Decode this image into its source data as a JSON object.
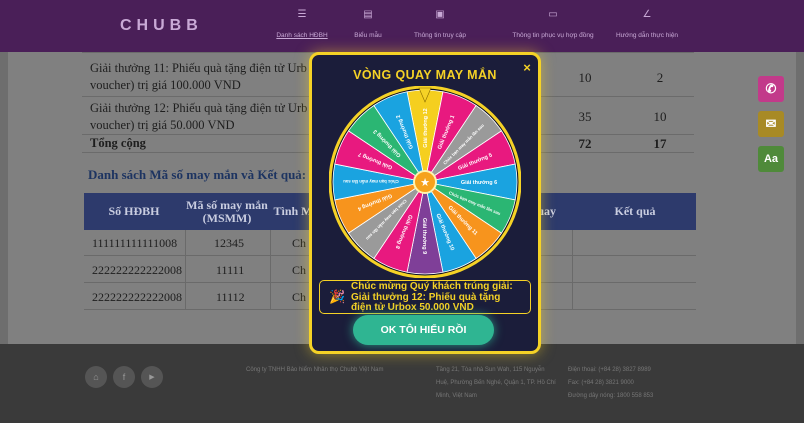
{
  "nav": {
    "logo": "CHUBB",
    "items": [
      {
        "label": "Danh sách HĐBH",
        "icon": "list-icon",
        "glyph": "☰"
      },
      {
        "label": "Biểu mẫu",
        "icon": "document-icon",
        "glyph": "▤"
      },
      {
        "label": "Thông tin truy cập",
        "icon": "user-card-icon",
        "glyph": "▣"
      },
      {
        "label": "Thông tin phục vụ hợp đồng",
        "icon": "chat-icon",
        "glyph": "▭"
      },
      {
        "label": "Hướng dẫn thực hiện",
        "icon": "pen-icon",
        "glyph": "∠"
      }
    ]
  },
  "prizes": [
    {
      "line1": "Giải thưởng 11: Phiếu quà tặng điện tử Urb",
      "line2": "voucher) trị giá 100.000 VND",
      "a": "10",
      "b": "2"
    },
    {
      "line1": "Giải thưởng 12: Phiếu quà tặng điện tử Urb",
      "line2": "voucher) trị giá 50.000 VND",
      "a": "35",
      "b": "10"
    }
  ],
  "total": {
    "label": "Tổng cộng",
    "a": "72",
    "b": "17"
  },
  "lucky": {
    "title": "Danh sách Mã số may mắn và Kết quả:",
    "headers": [
      "Số HĐBH",
      "Mã số may mắn (MSMM)",
      "Tình M",
      "Quay",
      "Kết quả"
    ],
    "rows": [
      {
        "policy": "111111111111008",
        "code": "12345",
        "status": "Ch"
      },
      {
        "policy": "222222222222008",
        "code": "11111",
        "status": "Ch"
      },
      {
        "policy": "222222222222008",
        "code": "11112",
        "status": "Ch"
      }
    ]
  },
  "side_buttons": [
    {
      "name": "phone-icon",
      "glyph": "✆",
      "color": "#c23a8a"
    },
    {
      "name": "chat-bubble-icon",
      "glyph": "✉",
      "color": "#a88a25"
    },
    {
      "name": "font-size-icon",
      "glyph": "Aa",
      "color": "#4f8a3a"
    }
  ],
  "footer": {
    "social": [
      {
        "name": "home-icon",
        "glyph": "⌂"
      },
      {
        "name": "facebook-icon",
        "glyph": "f"
      },
      {
        "name": "youtube-icon",
        "glyph": "▶"
      }
    ],
    "company": "Công ty TNHH Bảo hiểm Nhân thọ Chubb Việt Nam",
    "address": "Tầng 21, Tòa nhà Sun Wah, 115 Nguyễn Huệ, Phường Bến Nghé, Quận 1, TP. Hồ Chí Minh, Việt Nam",
    "phone": "Điện thoại: (+84 28) 3827 8989",
    "fax": "Fax: (+84 28) 3821 9000",
    "hotline": "Đường dây nóng: 1800 558 853"
  },
  "modal": {
    "title": "VÒNG QUAY MAY MẮN",
    "close_label": "×",
    "result_line1": "Chúc mừng Quý khách trúng giải:",
    "result_line2": "Giải thưởng 12: Phiếu quà tặng",
    "result_line3": "điện tử Urbox 50.000 VND",
    "ok_label": "OK TÔI HIỂU RỒI",
    "segments": [
      {
        "label": "Giải thưởng 12",
        "color": "#f5cf1f"
      },
      {
        "label": "Giải thưởng 1",
        "color": "#e8197f"
      },
      {
        "label": "Chúc bạn may mắn lần sau",
        "color": "#9a9a9a"
      },
      {
        "label": "Giải thưởng 5",
        "color": "#e8197f"
      },
      {
        "label": "Giải thưởng 6",
        "color": "#1aa3e0"
      },
      {
        "label": "Chúc bạn may mắn lần sau",
        "color": "#2bb673"
      },
      {
        "label": "Giải thưởng 11",
        "color": "#f7941d"
      },
      {
        "label": "Giải thưởng 10",
        "color": "#1aa3e0"
      },
      {
        "label": "Giải thưởng 9",
        "color": "#7f3f98"
      },
      {
        "label": "Giải thưởng 8",
        "color": "#e8197f"
      },
      {
        "label": "Chúc bạn may mắn lần sau",
        "color": "#9a9a9a"
      },
      {
        "label": "Giải thưởng 4",
        "color": "#f7941d"
      },
      {
        "label": "Chúc bạn may mắn lần sau",
        "color": "#1aa3e0"
      },
      {
        "label": "Giải thưởng 7",
        "color": "#e8197f"
      },
      {
        "label": "Giải thưởng 3",
        "color": "#2bb673"
      },
      {
        "label": "Giải thưởng 2",
        "color": "#1aa3e0"
      }
    ]
  }
}
